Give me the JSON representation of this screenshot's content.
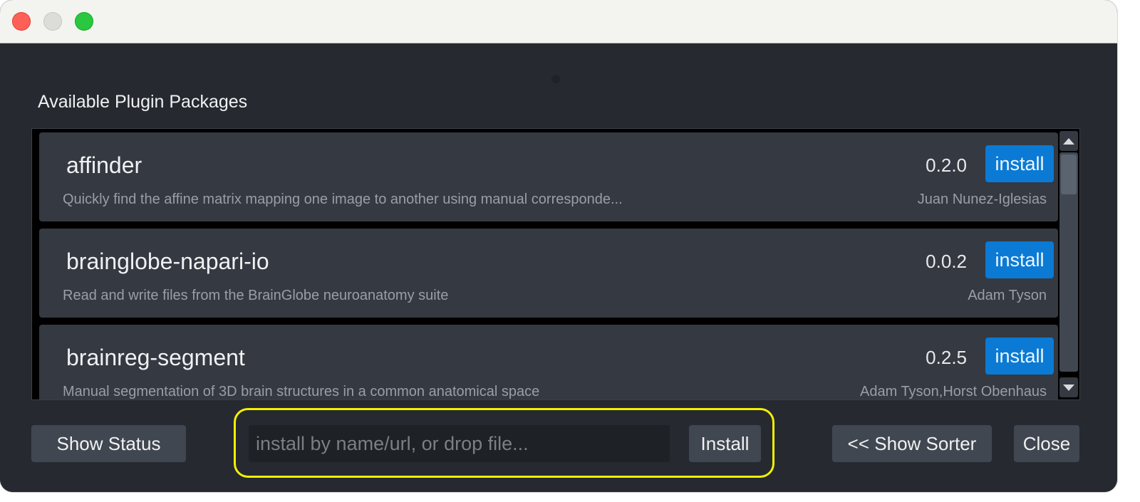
{
  "window": {
    "traffic_lights": [
      "close",
      "minimize",
      "maximize"
    ]
  },
  "section_title": "Available Plugin Packages",
  "packages": [
    {
      "name": "affinder",
      "description": "Quickly find the affine matrix mapping one image to another using manual corresponde...",
      "version": "0.2.0",
      "author": "Juan Nunez-Iglesias",
      "action_label": "install"
    },
    {
      "name": "brainglobe-napari-io",
      "description": "Read and write files from the BrainGlobe neuroanatomy suite",
      "version": "0.0.2",
      "author": "Adam Tyson",
      "action_label": "install"
    },
    {
      "name": "brainreg-segment",
      "description": "Manual segmentation of 3D brain structures in a common anatomical space",
      "version": "0.2.5",
      "author": "Adam Tyson,Horst Obenhaus",
      "action_label": "install"
    }
  ],
  "footer": {
    "show_status_label": "Show Status",
    "install_input_placeholder": "install by name/url, or drop file...",
    "install_input_value": "",
    "install_button_label": "Install",
    "show_sorter_label": "<< Show Sorter",
    "close_label": "Close"
  },
  "colors": {
    "accent": "#0a7ad4",
    "highlight": "#f2f000",
    "background": "#262930"
  }
}
